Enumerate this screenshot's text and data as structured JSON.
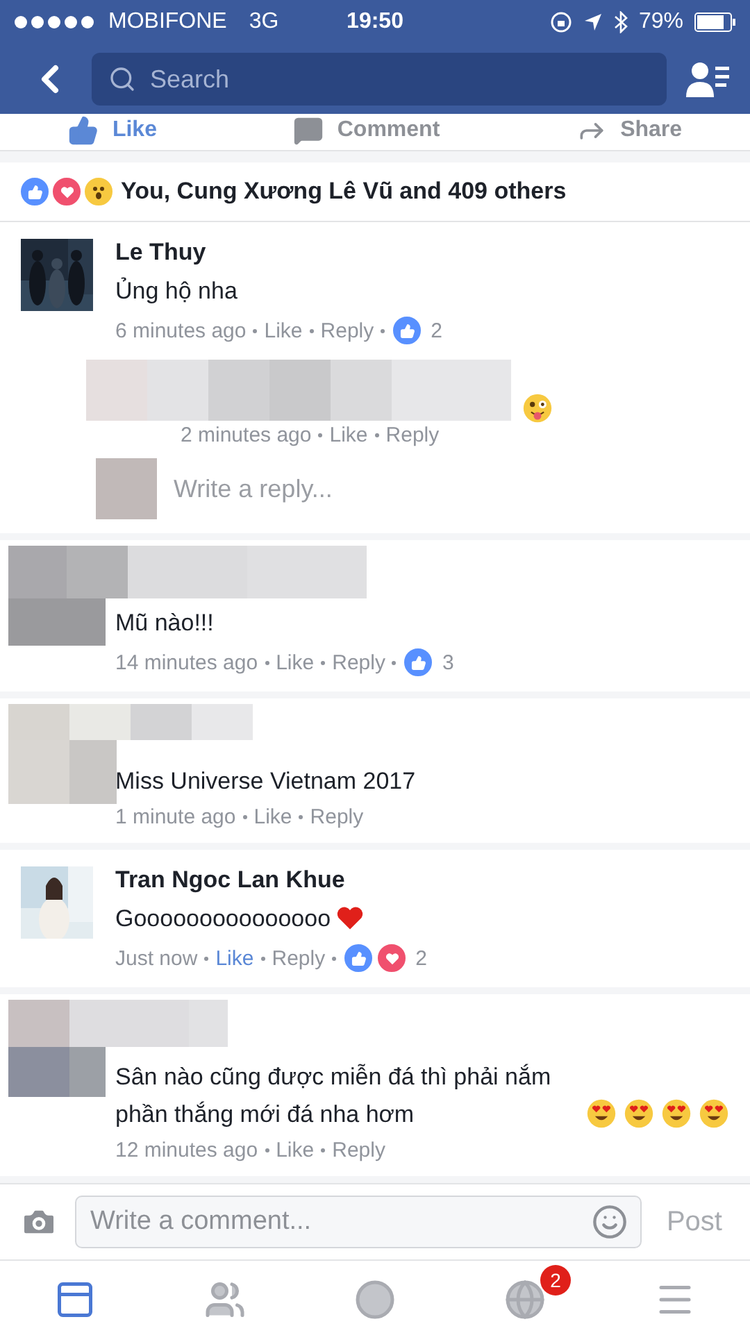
{
  "status_bar": {
    "carrier": "MOBIFONE",
    "network": "3G",
    "time": "19:50",
    "battery": "79%"
  },
  "nav": {
    "search": {
      "placeholder": "Search"
    }
  },
  "actions": [
    {
      "label": "Like",
      "kind": "like",
      "selected": true
    },
    {
      "label": "Comment",
      "kind": "comment",
      "selected": false
    },
    {
      "label": "Share",
      "kind": "share",
      "selected": false
    }
  ],
  "reactions_summary": {
    "reactions": [
      {
        "kind": "like"
      },
      {
        "kind": "love"
      },
      {
        "kind": "wow"
      }
    ],
    "text": "You, Cung Xương Lê Vũ and 409 others"
  },
  "comments": [
    {
      "author": "Le Thuy",
      "author_hidden": false,
      "text": "Ủng hộ nha",
      "time": "6 minutes ago",
      "like": "Like",
      "liked": false,
      "reply": "Reply",
      "reactions": [
        {
          "kind": "like"
        }
      ],
      "count": "2",
      "replies": [
        {
          "time": "2 minutes ago",
          "like": "Like",
          "liked": false,
          "reply": "Reply",
          "emoji": [
            {
              "kind": "tongue_wink"
            }
          ]
        }
      ],
      "reply_box": {
        "placeholder": "Write a reply..."
      }
    },
    {
      "author_hidden": true,
      "text": "Mũ nào!!!",
      "time": "14 minutes ago",
      "like": "Like",
      "liked": false,
      "reply": "Reply",
      "reactions": [
        {
          "kind": "like"
        }
      ],
      "count": "3"
    },
    {
      "author_hidden": true,
      "text": "Miss Universe Vietnam 2017",
      "time": "1 minute ago",
      "like": "Like",
      "liked": false,
      "reply": "Reply"
    },
    {
      "author": "Tran Ngoc Lan Khue",
      "author_hidden": false,
      "text": "Gooooooooooooooo",
      "emoji": [
        {
          "kind": "heart"
        }
      ],
      "time": "Just now",
      "like": "Like",
      "liked": true,
      "reply": "Reply",
      "reactions": [
        {
          "kind": "like"
        },
        {
          "kind": "love"
        }
      ],
      "count": "2"
    },
    {
      "author_hidden": true,
      "text": "Sân nào cũng được miễn đá thì phải nắm phần thắng mới đá nha hơm",
      "emoji": [
        {
          "kind": "heart_eyes"
        },
        {
          "kind": "heart_eyes"
        },
        {
          "kind": "heart_eyes"
        },
        {
          "kind": "heart_eyes"
        }
      ],
      "time": "12 minutes ago",
      "like": "Like",
      "liked": false,
      "reply": "Reply"
    }
  ],
  "composer": {
    "placeholder": "Write a comment...",
    "post": "Post",
    "disabled": true
  },
  "tab_bar": [
    {
      "kind": "feed",
      "selected": true
    },
    {
      "kind": "friends",
      "selected": false
    },
    {
      "kind": "video",
      "selected": false
    },
    {
      "kind": "notifications",
      "selected": false,
      "badge": "2"
    },
    {
      "kind": "menu",
      "selected": false
    }
  ]
}
